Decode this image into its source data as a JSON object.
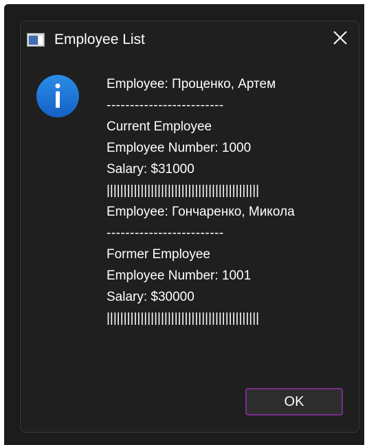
{
  "window": {
    "title": "Employee List",
    "icons": {
      "app": "window-app-icon",
      "close": "close-icon",
      "info": "info-icon"
    },
    "colors": {
      "background": "#1f1f1f",
      "text": "#ffffff",
      "info_blue": "#1a73d6",
      "ok_border": "#7a2d8c"
    }
  },
  "message": {
    "lines": [
      "Employee: Проценко, Артем",
      "-------------------------",
      "Current Employee",
      "Employee Number: 1000",
      "Salary: $31000",
      "|||||||||||||||||||||||||||||||||||||||||||||",
      "Employee: Гончаренко, Микола",
      "-------------------------",
      "Former Employee",
      "Employee Number: 1001",
      "Salary: $30000",
      "|||||||||||||||||||||||||||||||||||||||||||||"
    ]
  },
  "buttons": {
    "ok_label": "OK"
  }
}
